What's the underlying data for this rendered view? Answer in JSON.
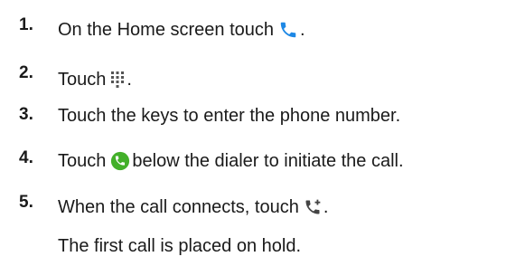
{
  "steps": [
    {
      "number": "1.",
      "before": "On the Home screen touch",
      "icon": "phone-icon",
      "after": "."
    },
    {
      "number": "2.",
      "before": "Touch",
      "icon": "dialpad-icon",
      "after": "."
    },
    {
      "number": "3.",
      "text": "Touch the keys to enter the phone number."
    },
    {
      "number": "4.",
      "before": "Touch",
      "icon": "call-button-icon",
      "after": "below the dialer to initiate the call."
    },
    {
      "number": "5.",
      "before": "When the call connects, touch",
      "icon": "add-call-icon",
      "after": "."
    }
  ],
  "note": "The first call is placed on hold.",
  "colors": {
    "text": "#1a1a1a",
    "phone_icon": "#1e88e5",
    "call_button": "#43b02a",
    "grey_icon": "#555555"
  }
}
